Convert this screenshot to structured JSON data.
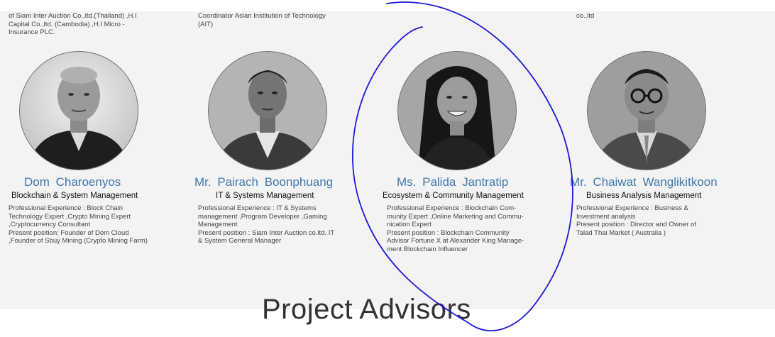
{
  "top_texts": {
    "left": "of Siam Inter Auction Co.,ltd.(Thailand) ,H.I Capital Co.,ltd. (Cambodia) ,H.I Micro - Insurance PLC.",
    "middle": "Coordinator Asian Institution of Technology (AIT)",
    "right": "co.,ltd"
  },
  "members": [
    {
      "name": "Dom Charoenyos",
      "role": "Blockchain & System Management",
      "experience": "Professional Experience : Block Chain Technology Expert ,Crypto Mining Expert ,Cryptocurrency Consultant",
      "position": "Present position: Founder of Dom Cloud ,Founder of Sbuy Mining (Crypto Mining Farm)"
    },
    {
      "name": "Mr. Pairach Boonphuang",
      "role": "IT & Systems Management",
      "experience": "Professional Experience : IT & Systems management ,Program Developer ,Gaming Management",
      "position": "Present position : Siam Inter Auction co.ltd. IT & System General Manager"
    },
    {
      "name": "Ms. Palida Jantratip",
      "role": "Ecosystem & Community Management",
      "experience": "Professional Experience : Blockchain Com- munity Expert ,Online Marketing and Commu- nication Expert",
      "position": "Present position : Blockchain Community Advisor Fortune X at Alexander King Manage- ment Blockchain Influencer"
    },
    {
      "name": "Mr. Chaiwat Wanglikitkoon",
      "role": "Business Analysis Management",
      "experience": "Professional Experience : Business & Investment analysis",
      "position": "Present position : Director and Owner of Talad Thai Market ( Australia )"
    }
  ],
  "section_title": "Project Advisors",
  "annotation_color": "#1a1adb"
}
